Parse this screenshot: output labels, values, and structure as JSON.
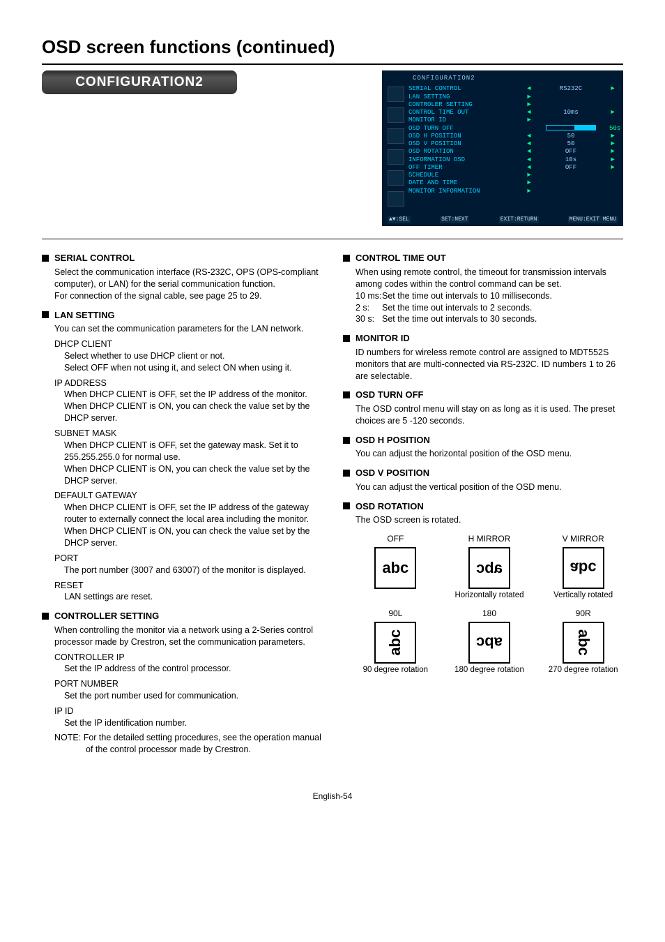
{
  "page_title": "OSD screen functions (continued)",
  "section_header": "CONFIGURATION2",
  "page_number": "English-54",
  "osd": {
    "title": "CONFIGURATION2",
    "rows": [
      {
        "label": "SERIAL CONTROL",
        "val": "RS232C",
        "la": "◄",
        "ra": "►"
      },
      {
        "label": "LAN SETTING",
        "val": "",
        "la": "►",
        "ra": ""
      },
      {
        "label": "CONTROLER SETTING",
        "val": "",
        "la": "►",
        "ra": ""
      },
      {
        "label": "CONTROL TIME OUT",
        "val": "10ms",
        "la": "◄",
        "ra": "►"
      },
      {
        "label": "MONITOR ID",
        "val": "",
        "la": "►",
        "ra": ""
      },
      {
        "label": "OSD TURN OFF",
        "val": "bar",
        "la": "",
        "ra": "50s"
      },
      {
        "label": "OSD H POSITION",
        "val": "50",
        "la": "◄",
        "ra": "►"
      },
      {
        "label": "OSD V POSITION",
        "val": "50",
        "la": "◄",
        "ra": "►"
      },
      {
        "label": "OSD ROTATION",
        "val": "OFF",
        "la": "◄",
        "ra": "►"
      },
      {
        "label": "INFORMATION OSD",
        "val": "10s",
        "la": "◄",
        "ra": "►"
      },
      {
        "label": "OFF TIMER",
        "val": "OFF",
        "la": "◄",
        "ra": "►"
      },
      {
        "label": "SCHEDULE",
        "val": "",
        "la": "►",
        "ra": ""
      },
      {
        "label": "DATE AND TIME",
        "val": "",
        "la": "►",
        "ra": ""
      },
      {
        "label": "MONITOR INFORMATION",
        "val": "",
        "la": "►",
        "ra": ""
      }
    ],
    "footer": {
      "sel": "▲▼:SEL",
      "next": "SET:NEXT",
      "ret": "EXIT:RETURN",
      "menu": "MENU:EXIT MENU"
    }
  },
  "left": {
    "serial": {
      "title": "SERIAL CONTROL",
      "p1": "Select the communication interface (RS-232C, OPS (OPS-compliant computer), or LAN) for the serial communication function.",
      "p2": "For connection of the signal cable, see page 25 to 29."
    },
    "lan": {
      "title": "LAN SETTING",
      "p1": "You can set the communication parameters for the LAN network.",
      "dhcp_h": "DHCP CLIENT",
      "dhcp_b1": "Select whether to use DHCP client or not.",
      "dhcp_b2": "Select OFF when not using it, and select ON when using it.",
      "ip_h": "IP ADDRESS",
      "ip_b1": "When DHCP CLIENT is OFF, set the IP address of the monitor.",
      "ip_b2": "When DHCP CLIENT is ON, you can check the value set by the DHCP server.",
      "sm_h": "SUBNET MASK",
      "sm_b1": "When DHCP CLIENT is OFF, set the gateway mask. Set it to 255.255.255.0 for normal use.",
      "sm_b2": "When DHCP CLIENT is ON, you can check the value set by the DHCP server.",
      "dg_h": "DEFAULT GATEWAY",
      "dg_b1": "When DHCP CLIENT is OFF, set the IP address of the gateway router to externally connect the local area including the monitor.",
      "dg_b2": "When DHCP CLIENT is ON, you can check the value set by the DHCP server.",
      "port_h": "PORT",
      "port_b": "The port number (3007 and 63007) of the monitor is displayed.",
      "reset_h": "RESET",
      "reset_b": "LAN settings are reset."
    },
    "ctrl": {
      "title": "CONTROLLER SETTING",
      "p1": "When controlling the monitor via a network using a 2-Series control processor made by Crestron, set the communication parameters.",
      "cip_h": "CONTROLLER IP",
      "cip_b": "Set the IP address of the control processor.",
      "pn_h": "PORT NUMBER",
      "pn_b": "Set the port number used for communication.",
      "ipid_h": "IP ID",
      "ipid_b": "Set the IP identification number.",
      "note_k": "NOTE:",
      "note_b": "For the detailed setting procedures, see the operation manual of the control processor made by Crestron."
    }
  },
  "right": {
    "cto": {
      "title": "CONTROL TIME OUT",
      "p1": "When using remote control, the timeout for transmission intervals among codes within the control command can be set.",
      "r1k": "10 ms:",
      "r1v": "Set the time out intervals to 10 milliseconds.",
      "r2k": "2 s:",
      "r2v": "Set the time out intervals to 2 seconds.",
      "r3k": "30 s:",
      "r3v": "Set the time out intervals to 30 seconds."
    },
    "mid": {
      "title": "MONITOR ID",
      "p1": "ID numbers for wireless remote control are assigned to MDT552S monitors that are multi-connected via RS-232C. ID numbers 1 to 26 are selectable."
    },
    "oto": {
      "title": "OSD TURN OFF",
      "p1": "The OSD control menu will stay on as long as it is used. The preset choices are 5 -120 seconds."
    },
    "ohp": {
      "title": "OSD H POSITION",
      "p1": "You can adjust the horizontal position of the OSD menu."
    },
    "ovp": {
      "title": "OSD V POSITION",
      "p1": "You can adjust the vertical position of the OSD menu."
    },
    "orot": {
      "title": "OSD ROTATION",
      "p1": "The OSD screen is rotated.",
      "cells": {
        "off": {
          "cap": "OFF",
          "sub": ""
        },
        "hmir": {
          "cap": "H MIRROR",
          "sub": "Horizontally rotated"
        },
        "vmir": {
          "cap": "V MIRROR",
          "sub": "Vertically rotated"
        },
        "l90": {
          "cap": "90L",
          "sub": "90 degree rotation"
        },
        "r180": {
          "cap": "180",
          "sub": "180 degree rotation"
        },
        "r90": {
          "cap": "90R",
          "sub": "270 degree rotation"
        }
      },
      "glyph": "abc"
    }
  }
}
